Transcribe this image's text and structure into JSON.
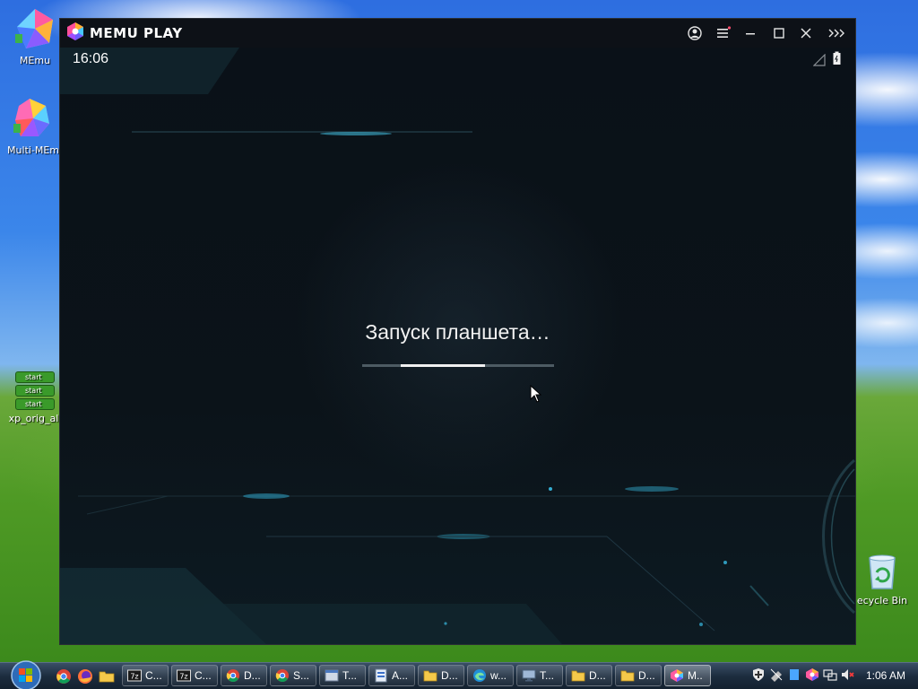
{
  "desktop": {
    "icons": [
      {
        "label": "MEmu"
      },
      {
        "label": "Multi-MEm"
      },
      {
        "label": "xp_orig_all",
        "badges": [
          "start",
          "start",
          "start"
        ]
      },
      {
        "label": "ecycle Bin"
      }
    ]
  },
  "memu": {
    "title": "MEMU PLAY",
    "controls": [
      "user-icon",
      "menu-icon",
      "minimize-icon",
      "maximize-icon",
      "close-icon",
      "more-icon"
    ],
    "android": {
      "time": "16:06",
      "boot_text": "Запуск планшета…",
      "progress": {
        "start": 0.2,
        "end": 0.64
      }
    }
  },
  "taskbar": {
    "quick_launch": [
      "chrome-icon",
      "firefox-icon",
      "folder-icon"
    ],
    "buttons": [
      {
        "icon": "7zip-icon",
        "label": "C..."
      },
      {
        "icon": "7zip-icon",
        "label": "C..."
      },
      {
        "icon": "chrome-icon",
        "label": "D..."
      },
      {
        "icon": "chrome-icon",
        "label": "S..."
      },
      {
        "icon": "window-icon",
        "label": "T..."
      },
      {
        "icon": "app-icon",
        "label": "A..."
      },
      {
        "icon": "folder-icon",
        "label": "D..."
      },
      {
        "icon": "edge-icon",
        "label": "w..."
      },
      {
        "icon": "monitor-icon",
        "label": "T..."
      },
      {
        "icon": "folder-icon",
        "label": "D..."
      },
      {
        "icon": "folder-icon",
        "label": "D..."
      },
      {
        "icon": "memu-icon",
        "label": "M..",
        "active": true
      }
    ],
    "tray": [
      "shield-icon",
      "network-icon",
      "blue-icon",
      "color-icon",
      "network-icon",
      "volume-muted-icon"
    ],
    "clock": "1:06 AM"
  },
  "colors": {
    "memu_bg": "#0c131a",
    "progress_fill": "#f0f0f0",
    "progress_track": "#4d5b63",
    "taskbar": "#1c2c3e"
  }
}
